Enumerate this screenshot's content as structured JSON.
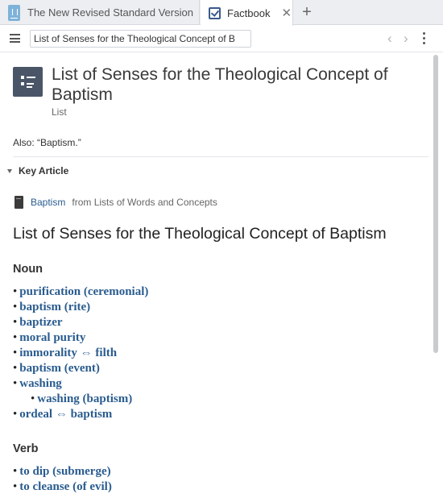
{
  "tabs": [
    {
      "label": "The New Revised Standard Version"
    },
    {
      "label": "Factbook",
      "close": "✕"
    }
  ],
  "new_tab": "+",
  "toolbar": {
    "title_value": "List of Senses for the Theological Concept of B",
    "back": "‹",
    "forward": "›"
  },
  "header": {
    "title": "List of Senses for the Theological Concept of Baptism",
    "type": "List"
  },
  "also": "Also: “Baptism.”",
  "key_article": {
    "heading": "Key Article",
    "link": "Baptism",
    "from": "from Lists of Words and Concepts"
  },
  "article": {
    "title": "List of Senses for the Theological Concept of Baptism",
    "noun_heading": "Noun",
    "verb_heading": "Verb",
    "bullet": "•",
    "nouns": [
      {
        "text": "purification (ceremonial)"
      },
      {
        "text": "baptism (rite)"
      },
      {
        "text": "baptizer"
      },
      {
        "text": "moral purity"
      },
      {
        "text": "immorality ⇔ filth"
      },
      {
        "text": "baptism (event)"
      },
      {
        "text": "washing"
      },
      {
        "text": "washing (baptism)"
      },
      {
        "text": "ordeal ⇔ baptism"
      }
    ],
    "verbs": [
      {
        "text": "to dip (submerge)"
      },
      {
        "text": "to cleanse (of evil)"
      }
    ]
  }
}
